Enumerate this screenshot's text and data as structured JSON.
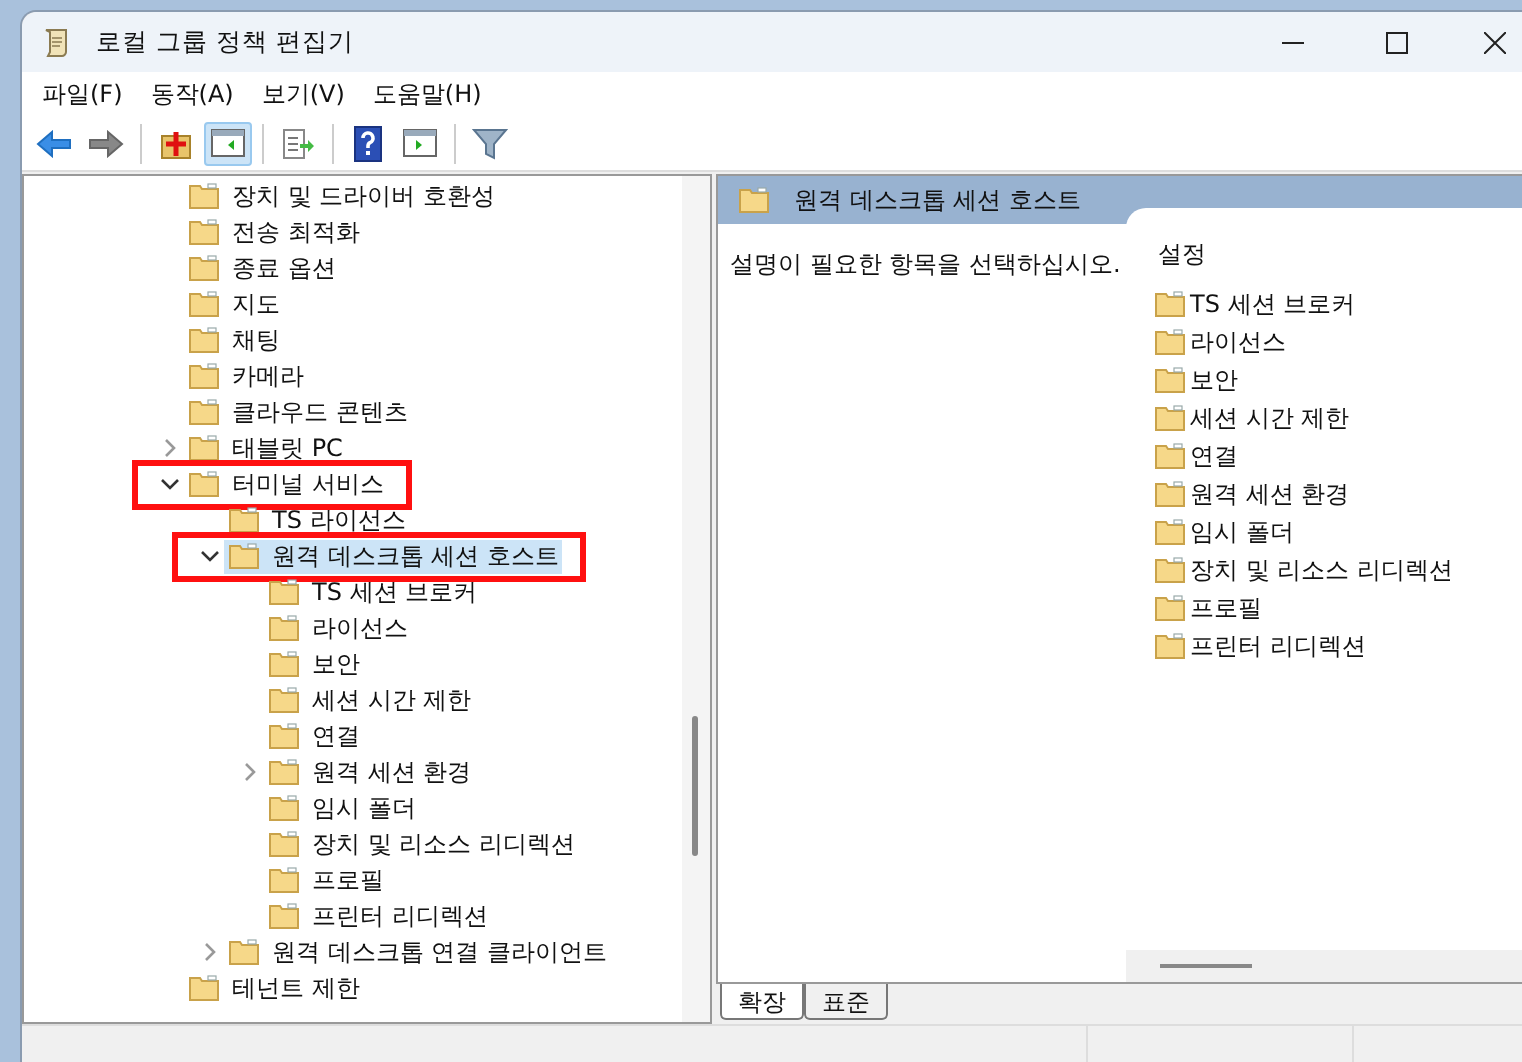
{
  "window": {
    "title": "로컬 그룹 정책 편집기"
  },
  "menu": [
    {
      "label": "파일(F)"
    },
    {
      "label": "동작(A)"
    },
    {
      "label": "보기(V)"
    },
    {
      "label": "도움말(H)"
    }
  ],
  "toolbar": [
    {
      "kind": "back",
      "pressed": false
    },
    {
      "kind": "forward",
      "pressed": false
    },
    {
      "kind": "sep"
    },
    {
      "kind": "up",
      "pressed": false
    },
    {
      "kind": "tree",
      "pressed": true
    },
    {
      "kind": "sep"
    },
    {
      "kind": "export",
      "pressed": false
    },
    {
      "kind": "sep"
    },
    {
      "kind": "help",
      "pressed": false
    },
    {
      "kind": "pane",
      "pressed": false
    },
    {
      "kind": "sep"
    },
    {
      "kind": "filter",
      "pressed": false
    }
  ],
  "tree": [
    {
      "label": "장치 및 드라이버 호환성",
      "expandable": false,
      "selected": false,
      "highlighted": false
    },
    {
      "label": "전송 최적화",
      "expandable": false,
      "selected": false,
      "highlighted": false
    },
    {
      "label": "종료 옵션",
      "expandable": false,
      "selected": false,
      "highlighted": false
    },
    {
      "label": "지도",
      "expandable": false,
      "selected": false,
      "highlighted": false
    },
    {
      "label": "채팅",
      "expandable": false,
      "selected": false,
      "highlighted": false
    },
    {
      "label": "카메라",
      "expandable": false,
      "selected": false,
      "highlighted": false
    },
    {
      "label": "클라우드 콘텐츠",
      "expandable": false,
      "selected": false,
      "highlighted": false
    },
    {
      "label": "태블릿 PC",
      "expandable": true,
      "expanded": false,
      "selected": false,
      "highlighted": false
    },
    {
      "label": "터미널 서비스",
      "expandable": true,
      "expanded": true,
      "selected": false,
      "highlighted": true,
      "children": [
        {
          "label": "TS 라이선스",
          "expandable": false,
          "selected": false,
          "highlighted": false
        },
        {
          "label": "원격 데스크톱 세션 호스트",
          "expandable": true,
          "expanded": true,
          "selected": true,
          "highlighted": true,
          "children": [
            {
              "label": "TS 세션 브로커",
              "expandable": false,
              "selected": false,
              "highlighted": false
            },
            {
              "label": "라이선스",
              "expandable": false,
              "selected": false,
              "highlighted": false
            },
            {
              "label": "보안",
              "expandable": false,
              "selected": false,
              "highlighted": false
            },
            {
              "label": "세션 시간 제한",
              "expandable": false,
              "selected": false,
              "highlighted": false
            },
            {
              "label": "연결",
              "expandable": false,
              "selected": false,
              "highlighted": false
            },
            {
              "label": "원격 세션 환경",
              "expandable": true,
              "expanded": false,
              "selected": false,
              "highlighted": false
            },
            {
              "label": "임시 폴더",
              "expandable": false,
              "selected": false,
              "highlighted": false
            },
            {
              "label": "장치 및 리소스 리디렉션",
              "expandable": false,
              "selected": false,
              "highlighted": false
            },
            {
              "label": "프로필",
              "expandable": false,
              "selected": false,
              "highlighted": false
            },
            {
              "label": "프린터 리디렉션",
              "expandable": false,
              "selected": false,
              "highlighted": false
            }
          ]
        },
        {
          "label": "원격 데스크톱 연결 클라이언트",
          "expandable": true,
          "expanded": false,
          "selected": false,
          "highlighted": false
        }
      ]
    },
    {
      "label": "테넌트 제한",
      "expandable": false,
      "selected": false,
      "highlighted": false
    }
  ],
  "details": {
    "header": "원격 데스크톱 세션 호스트",
    "description": "설명이 필요한 항목을 선택하십시오.",
    "column": "설정",
    "items": [
      "TS 세션 브로커",
      "라이선스",
      "보안",
      "세션 시간 제한",
      "연결",
      "원격 세션 환경",
      "임시 폴더",
      "장치 및 리소스 리디렉션",
      "프로필",
      "프린터 리디렉션"
    ]
  },
  "tabs": [
    {
      "label": "확장",
      "selected": true
    },
    {
      "label": "표준",
      "selected": false
    }
  ]
}
